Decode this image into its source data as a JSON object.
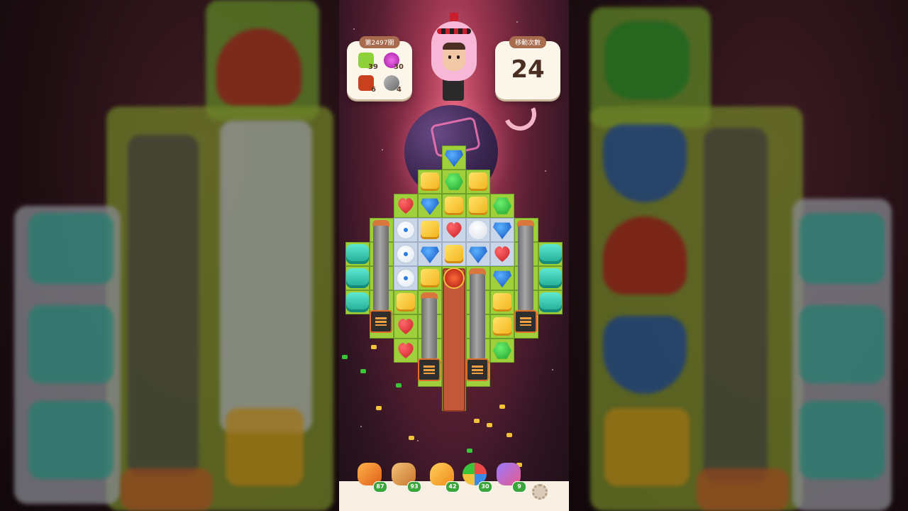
{
  "level": {
    "label": "第2497關"
  },
  "goals": [
    {
      "icon": "green-block-icon",
      "count": "39",
      "color": "#8fd13a"
    },
    {
      "icon": "purple-orb-icon",
      "count": "30",
      "color": "#d63ad0"
    },
    {
      "icon": "lantern-icon",
      "count": "6",
      "color": "#c8401e"
    },
    {
      "icon": "cannon-goal-icon",
      "count": "4",
      "color": "#8a8a8a"
    }
  ],
  "moves": {
    "label": "移動次數",
    "value": "24"
  },
  "boosters": [
    {
      "name": "hammer-booster",
      "count": "87",
      "color": "#f07a28"
    },
    {
      "name": "cannon-booster",
      "count": "93",
      "color": "#e9a35a"
    },
    {
      "name": "rocket-booster",
      "count": "42",
      "color": "#f2a93a"
    },
    {
      "name": "pinwheel-booster",
      "count": "30",
      "color": "#e84a4a"
    },
    {
      "name": "card-booster",
      "count": "9",
      "color": "#7a5ad8"
    }
  ],
  "settings": {
    "icon": "gear-icon"
  }
}
